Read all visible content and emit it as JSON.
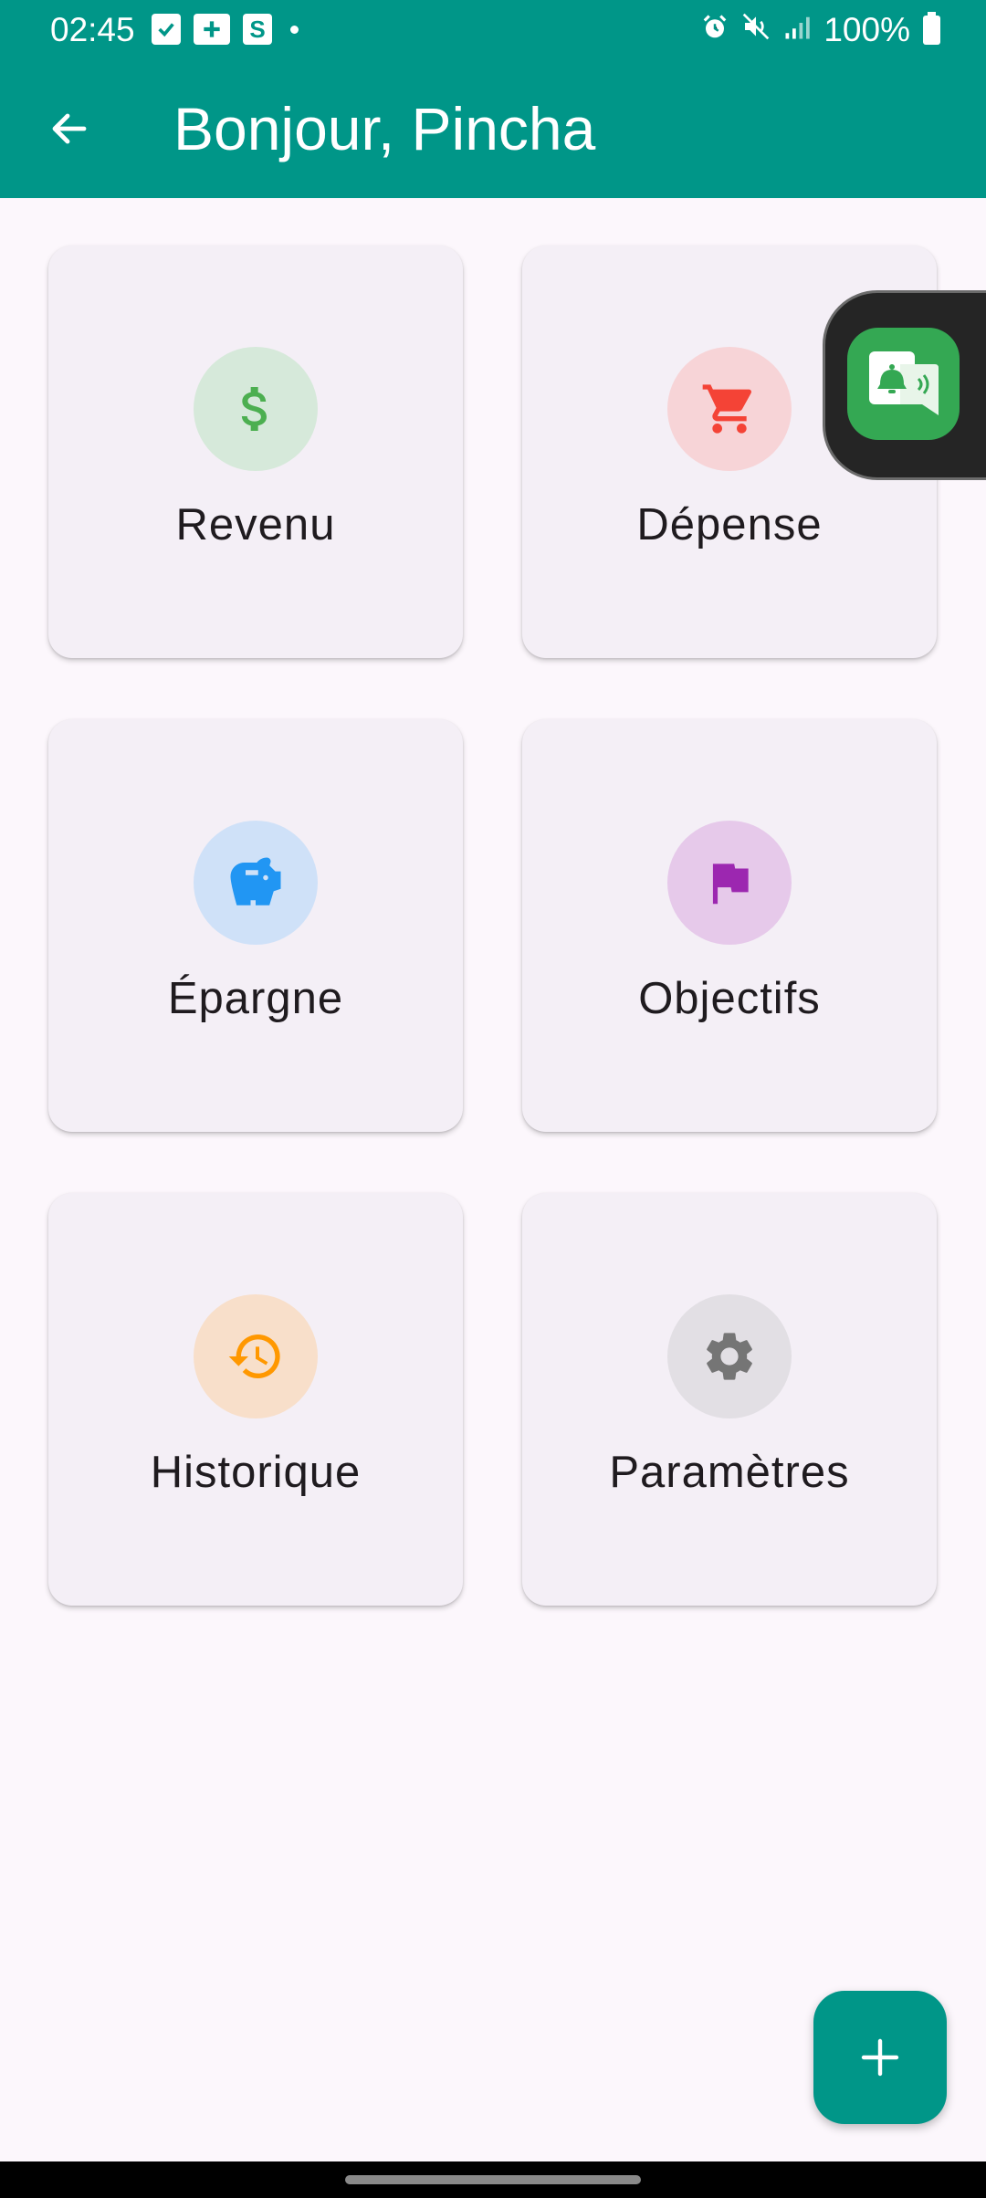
{
  "status_bar": {
    "time": "02:45",
    "battery": "100%",
    "left_icons": [
      "check-square-icon",
      "plus-square-icon",
      "s-square-icon"
    ],
    "s_letter": "S"
  },
  "app_bar": {
    "title": "Bonjour, Pincha",
    "color": "#009688"
  },
  "cards": [
    {
      "label": "Revenu",
      "icon": "dollar-icon",
      "icon_color": "#4caf50",
      "circle_color": "#d6e9da"
    },
    {
      "label": "Dépense",
      "icon": "cart-icon",
      "icon_color": "#f44336",
      "circle_color": "#f7d4d7"
    },
    {
      "label": "Épargne",
      "icon": "piggy-bank-icon",
      "icon_color": "#2196f3",
      "circle_color": "#cfe1f8"
    },
    {
      "label": "Objectifs",
      "icon": "flag-icon",
      "icon_color": "#9c27b0",
      "circle_color": "#e6c9ea"
    },
    {
      "label": "Historique",
      "icon": "history-icon",
      "icon_color": "#ff9800",
      "circle_color": "#f8dfca"
    },
    {
      "label": "Paramètres",
      "icon": "gear-icon",
      "icon_color": "#757575",
      "circle_color": "#e2dfe4"
    }
  ],
  "fab": {
    "icon": "plus-icon"
  },
  "floating_bubble": {
    "icon": "notification-reader-icon"
  }
}
